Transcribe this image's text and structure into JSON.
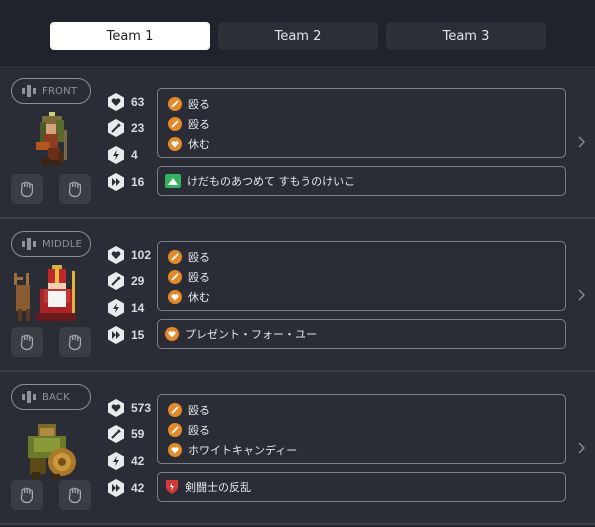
{
  "tabs": [
    {
      "label": "Team 1",
      "active": true
    },
    {
      "label": "Team 2",
      "active": false
    },
    {
      "label": "Team 3",
      "active": false
    }
  ],
  "units": [
    {
      "position": "FRONT",
      "stats": {
        "health": "63",
        "attack": "23",
        "speed": "4",
        "initiative": "16"
      },
      "skills": [
        {
          "label": "殴る",
          "icon": "sword-icon"
        },
        {
          "label": "殴る",
          "icon": "sword-icon"
        },
        {
          "label": "休む",
          "icon": "heart-icon"
        }
      ],
      "special": {
        "label": "けだものあつめて すもうのけいこ",
        "icon": "green-banner-icon"
      }
    },
    {
      "position": "MIDDLE",
      "stats": {
        "health": "102",
        "attack": "29",
        "speed": "14",
        "initiative": "15"
      },
      "skills": [
        {
          "label": "殴る",
          "icon": "sword-icon"
        },
        {
          "label": "殴る",
          "icon": "sword-icon"
        },
        {
          "label": "休む",
          "icon": "heart-icon"
        }
      ],
      "special": {
        "label": "プレゼント・フォー・ユー",
        "icon": "heart-icon"
      }
    },
    {
      "position": "BACK",
      "stats": {
        "health": "573",
        "attack": "59",
        "speed": "42",
        "initiative": "42"
      },
      "skills": [
        {
          "label": "殴る",
          "icon": "sword-icon"
        },
        {
          "label": "殴る",
          "icon": "sword-icon"
        },
        {
          "label": "ホワイトキャンディー",
          "icon": "heart-icon"
        }
      ],
      "special": {
        "label": "剣闘士の反乱",
        "icon": "red-shield-icon"
      }
    }
  ],
  "colors": {
    "accent_orange": "#e3892a",
    "background": "#20232b",
    "panel": "#2a2d35",
    "border": "#7c8089"
  }
}
